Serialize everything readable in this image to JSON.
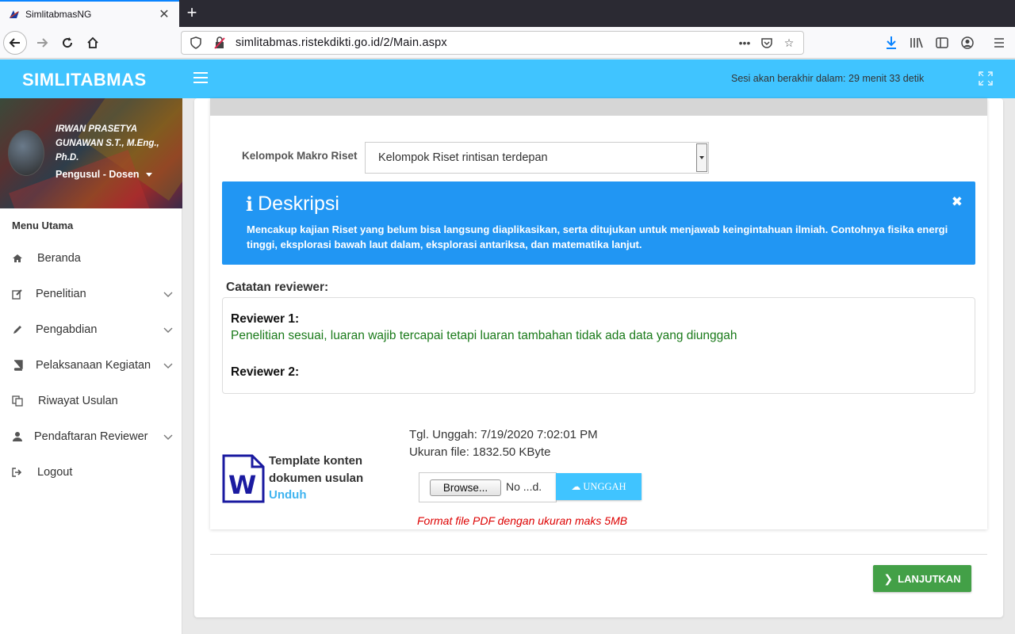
{
  "browser": {
    "tab_title": "SimlitabmasNG",
    "url": "simlitabmas.ristekdikti.go.id/2/Main.aspx"
  },
  "header": {
    "brand": "SIMLITABMAS",
    "session_text": "Sesi akan berakhir dalam: 29 menit 33 detik"
  },
  "profile": {
    "name": "IRWAN PRASETYA GUNAWAN S.T., M.Eng., Ph.D.",
    "role": "Pengusul - Dosen"
  },
  "sidebar": {
    "title": "Menu Utama",
    "items": [
      {
        "label": "Beranda",
        "icon": "home-icon",
        "expandable": false
      },
      {
        "label": "Penelitian",
        "icon": "edit-icon",
        "expandable": true
      },
      {
        "label": "Pengabdian",
        "icon": "pencil-icon",
        "expandable": true
      },
      {
        "label": "Pelaksanaan Kegiatan",
        "icon": "book-icon",
        "expandable": true
      },
      {
        "label": "Riwayat Usulan",
        "icon": "copy-icon",
        "expandable": false
      },
      {
        "label": "Pendaftaran Reviewer",
        "icon": "user-icon",
        "expandable": true
      },
      {
        "label": "Logout",
        "icon": "sign-out-icon",
        "expandable": false
      }
    ]
  },
  "form": {
    "field_label": "Kelompok Makro Riset",
    "selected_value": "Kelompok Riset rintisan terdepan"
  },
  "alert": {
    "title": "Deskripsi",
    "body": "Mencakup kajian Riset yang belum bisa langsung diaplikasikan, serta ditujukan untuk menjawab keingintahuan ilmiah. Contohnya fisika energi tinggi, eksplorasi bawah laut dalam, eksplorasi antariksa, dan matematika lanjut."
  },
  "reviewer": {
    "heading": "Catatan reviewer:",
    "r1_label": "Reviewer 1:",
    "r1_note": "Penelitian sesuai, luaran wajib tercapai tetapi luaran tambahan tidak ada data yang diunggah",
    "r2_label": "Reviewer 2:"
  },
  "upload": {
    "template_label": "Template konten dokumen usulan",
    "download_link": "Unduh",
    "upload_date": "Tgl. Unggah: 7/19/2020 7:02:01 PM",
    "file_size": "Ukuran file: 1832.50 KByte",
    "browse_label": "Browse...",
    "no_file_text": "No ...d.",
    "upload_button": "UNGGAH",
    "format_note": "Format file PDF dengan ukuran maks 5MB"
  },
  "footer": {
    "next_button": "LANJUTKAN"
  },
  "colors": {
    "header_bg": "#40c4ff",
    "alert_bg": "#2196f3",
    "next_button_bg": "#43a047",
    "format_note": "#dd0000",
    "reviewer_note": "#1a7a1a"
  }
}
